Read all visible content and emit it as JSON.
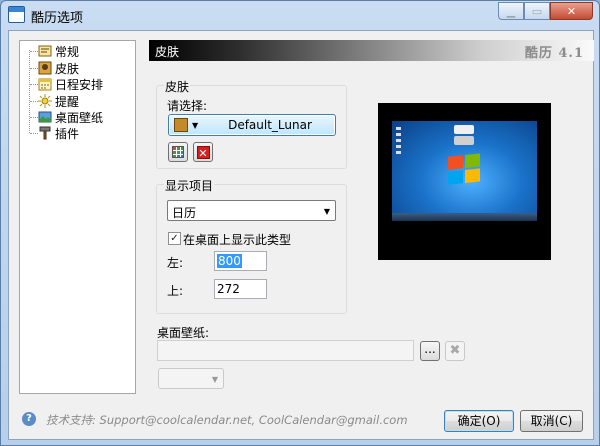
{
  "window": {
    "title": "酷历选项"
  },
  "tree": {
    "items": [
      {
        "label": "常规",
        "icon": "general-icon"
      },
      {
        "label": "皮肤",
        "icon": "skin-icon"
      },
      {
        "label": "日程安排",
        "icon": "schedule-icon"
      },
      {
        "label": "提醒",
        "icon": "reminder-icon"
      },
      {
        "label": "桌面壁纸",
        "icon": "wallpaper-icon"
      },
      {
        "label": "插件",
        "icon": "plugin-icon"
      }
    ],
    "selected": "皮肤"
  },
  "header": {
    "title": "皮肤",
    "version": "酷历 4.1"
  },
  "skin_group": {
    "title": "皮肤",
    "choose_label": "请选择:",
    "selected_skin": "Default_Lunar"
  },
  "display_group": {
    "title": "显示项目",
    "item_value": "日历",
    "show_on_desktop_label": "在桌面上显示此类型",
    "show_on_desktop_checked": true,
    "left_label": "左:",
    "left_value": "800",
    "top_label": "上:",
    "top_value": "272"
  },
  "wallpaper": {
    "label": "桌面壁纸:",
    "path_value": "",
    "browse_label": "...",
    "clear_label": "✖"
  },
  "footer": {
    "support_text": "技术支持: Support@coolcalendar.net, CoolCalendar@gmail.com",
    "ok_label": "确定(O)",
    "cancel_label": "取消(C)"
  },
  "colors": {
    "accent": "#3c7fb1",
    "selection": "#3399ff"
  }
}
